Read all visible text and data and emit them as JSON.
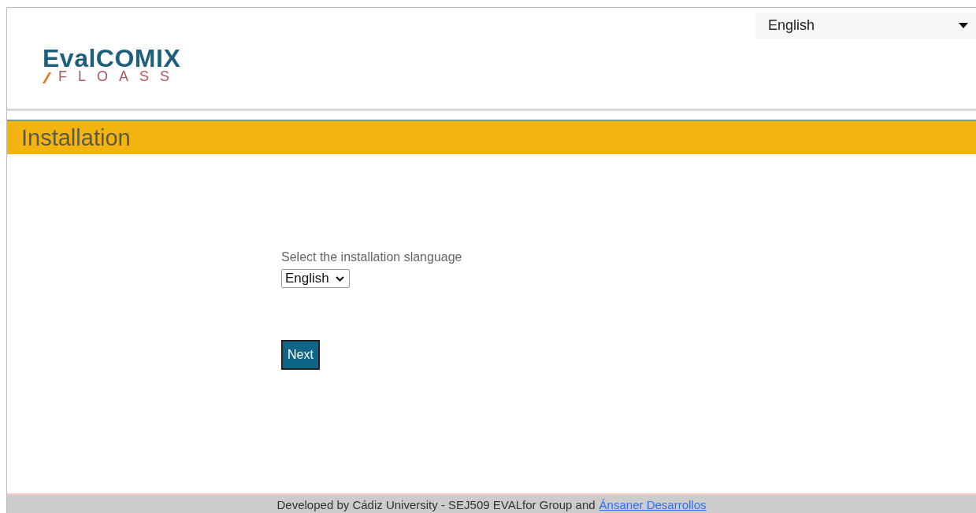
{
  "header": {
    "logo": {
      "wordmark": "EvalCOMIX",
      "subtitle": "FLOASS"
    },
    "language_menu": {
      "value": "English"
    }
  },
  "title_bar": {
    "title": "Installation"
  },
  "form": {
    "label": "Select the installation slanguage",
    "language_select": {
      "value": "English"
    },
    "next_button": "Next"
  },
  "footer": {
    "text": "Developed by Cádiz University - SEJ509 EVALfor Group and",
    "link": "Ánsaner Desarrollos"
  }
}
